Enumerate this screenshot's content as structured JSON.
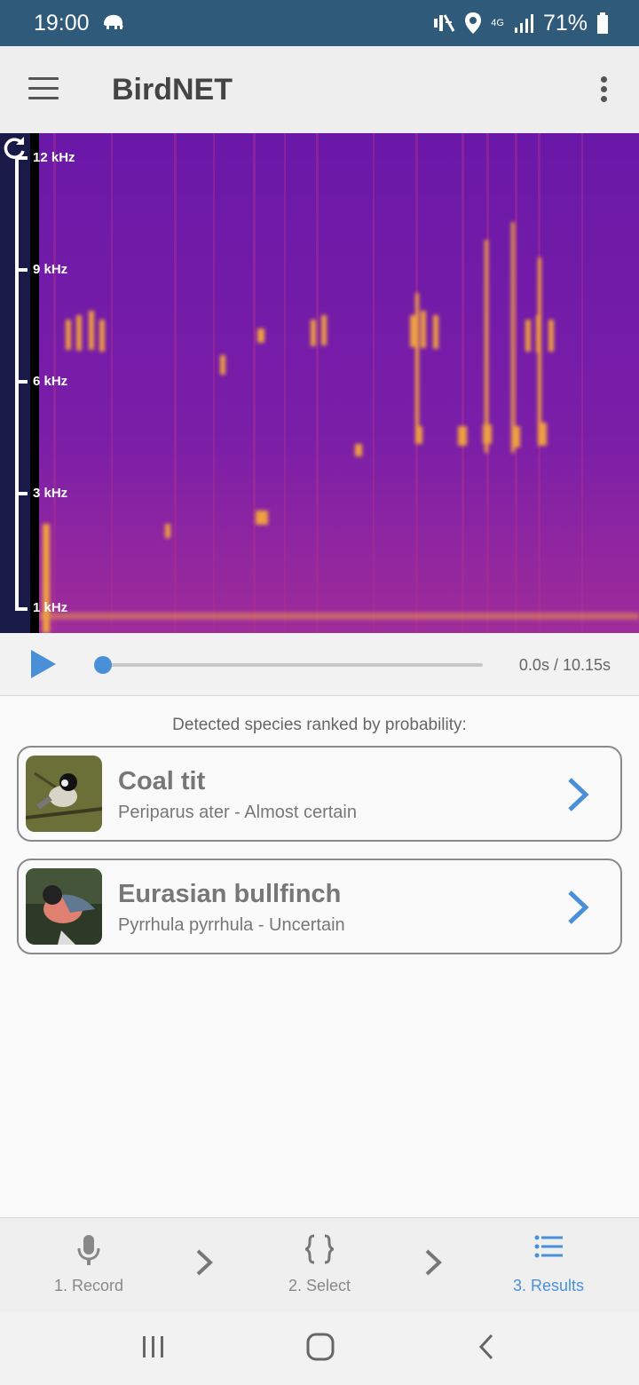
{
  "status_bar": {
    "time": "19:00",
    "battery": "71%",
    "network": "4G",
    "icons": [
      "elephant-icon",
      "mute-icon",
      "location-icon",
      "signal-icon",
      "battery-icon"
    ]
  },
  "app_bar": {
    "title": "BirdNET",
    "menu_icon": "menu-icon",
    "more_icon": "more-vertical-icon"
  },
  "spectrogram": {
    "frequency_labels": [
      "12 kHz",
      "9 kHz",
      "6 kHz",
      "3 kHz",
      "1 kHz"
    ],
    "refresh_icon": "refresh-icon"
  },
  "player": {
    "time": "0.0s / 10.15s",
    "progress": 0
  },
  "results": {
    "heading": "Detected species ranked by probability:",
    "species": [
      {
        "name": "Coal tit",
        "subtitle": "Periparus ater - Almost certain"
      },
      {
        "name": "Eurasian bullfinch",
        "subtitle": "Pyrrhula pyrrhula - Uncertain"
      }
    ]
  },
  "bottom_nav": {
    "steps": [
      {
        "label": "1. Record",
        "icon": "microphone-icon",
        "active": false
      },
      {
        "label": "2. Select",
        "icon": "braces-icon",
        "active": false
      },
      {
        "label": "3. Results",
        "icon": "list-icon",
        "active": true
      }
    ]
  },
  "colors": {
    "status_bar": "#2f5a7a",
    "accent": "#4a90d9",
    "spectrogram_base": "#5a14a0",
    "spectrogram_signal": "#f0a040"
  }
}
